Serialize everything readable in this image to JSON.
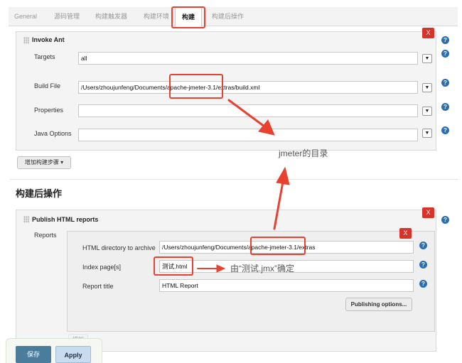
{
  "tabs": [
    "General",
    "源码管理",
    "构建触发器",
    "构建环境",
    "构建",
    "构建后操作"
  ],
  "build": {
    "step_title": "Invoke Ant",
    "remove_label": "X",
    "help_label": "?",
    "dropdown_label": "▼",
    "targets_label": "Targets",
    "targets_value": "all",
    "build_file_label": "Build File",
    "build_file_value": "/Users/zhoujunfeng/Documents/apache-jmeter-3.1/extras/build.xml",
    "properties_label": "Properties",
    "properties_value": "",
    "java_options_label": "Java Options",
    "java_options_value": "",
    "add_step_label": "增加构建步骤 ▾"
  },
  "post_build": {
    "section_title": "构建后操作",
    "publisher_title": "Publish HTML reports",
    "reports_label": "Reports",
    "dir_label": "HTML directory to archive",
    "dir_value": "/Users/zhoujunfeng/Documents/apache-jmeter-3.1/extras",
    "index_label": "Index page[s]",
    "index_value": "测试.html",
    "title_label": "Report title",
    "title_value": "HTML Report",
    "options_label": "Publishing options...",
    "add_label": "增加"
  },
  "annotations": {
    "jmeter_dir": "jmeter的目录",
    "index_note": "由“测试.jmx”确定"
  },
  "footer": {
    "save_label": "保存",
    "apply_label": "Apply"
  },
  "colors": {
    "annotation_red": "#e8412f",
    "save_button": "#4a7c9b",
    "apply_button": "#c9dcef",
    "help_blue": "#2a6fb3"
  }
}
